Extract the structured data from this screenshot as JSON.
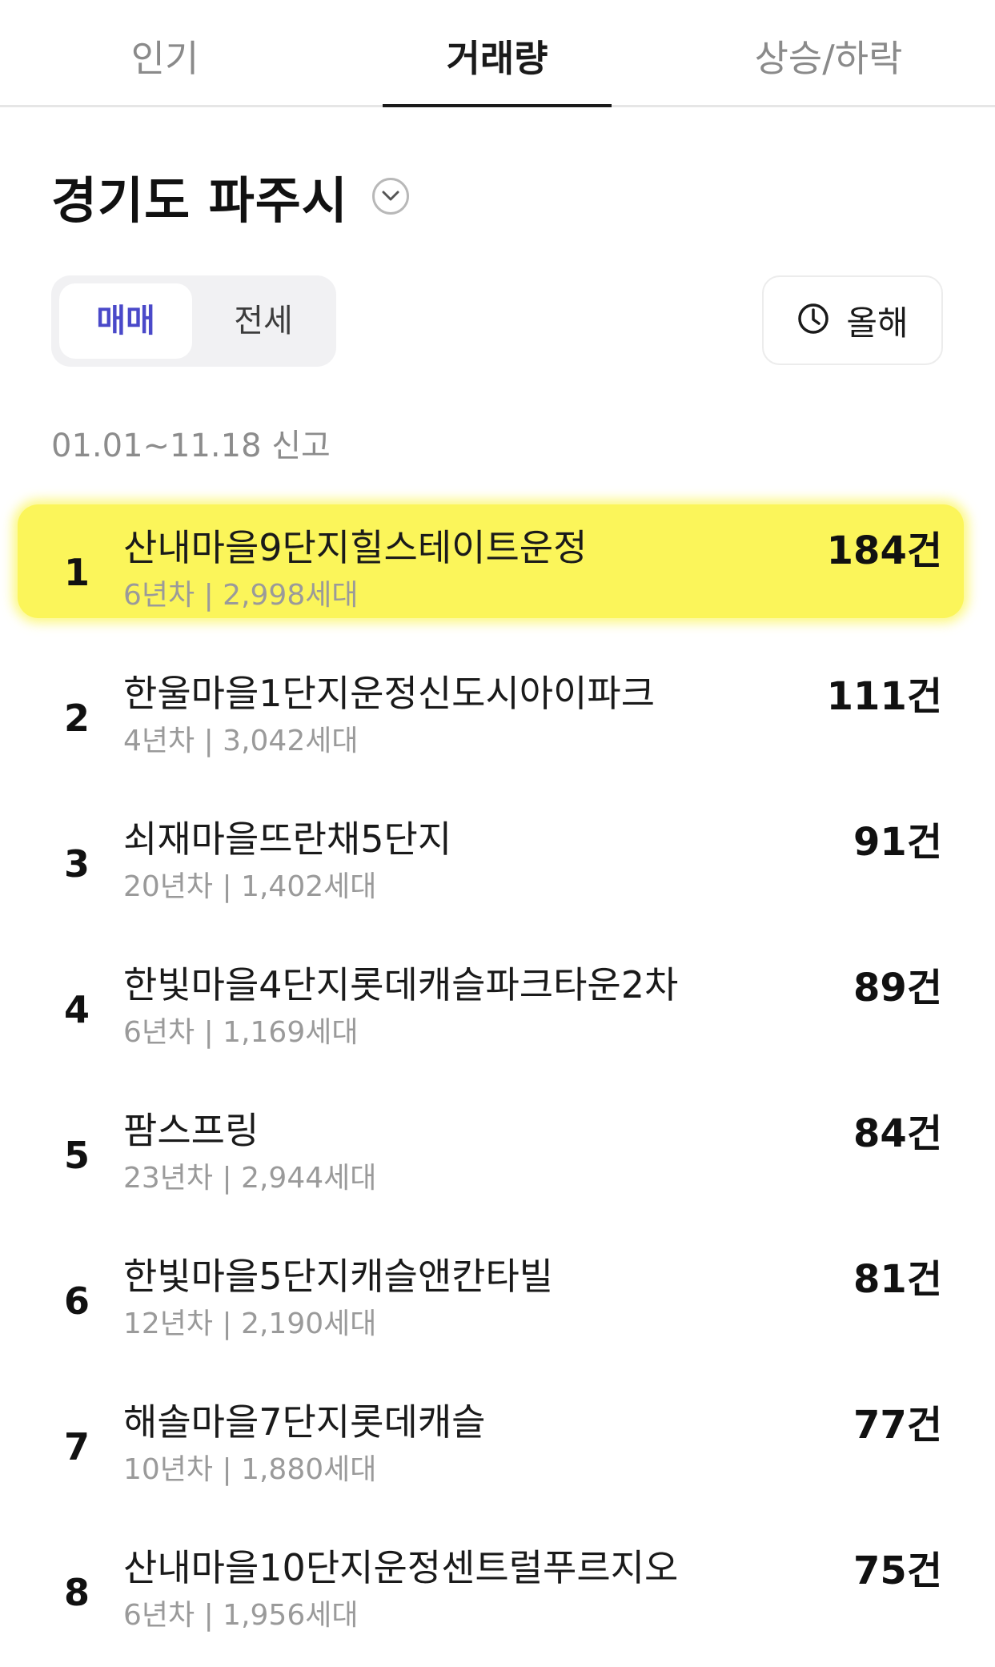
{
  "tabs": [
    {
      "label": "인기"
    },
    {
      "label": "거래량"
    },
    {
      "label": "상승/하락"
    }
  ],
  "active_tab": "거래량",
  "region": {
    "title": "경기도 파주시",
    "icon": "chevron-down-icon"
  },
  "segment": {
    "active": "매매",
    "inactive": "전세",
    "active_color": "#4a49c9"
  },
  "period": {
    "label": "올해",
    "icon": "clock-icon"
  },
  "date_range": "01.01~11.18 신고",
  "highlight_color": "#fbf55a",
  "rankings": [
    {
      "rank": "1",
      "name": "산내마을9단지힐스테이트운정",
      "meta": "6년차 | 2,998세대",
      "count": "184건"
    },
    {
      "rank": "2",
      "name": "한울마을1단지운정신도시아이파크",
      "meta": "4년차 | 3,042세대",
      "count": "111건"
    },
    {
      "rank": "3",
      "name": "쇠재마을뜨란채5단지",
      "meta": "20년차 | 1,402세대",
      "count": "91건"
    },
    {
      "rank": "4",
      "name": "한빛마을4단지롯데캐슬파크타운2차",
      "meta": "6년차 | 1,169세대",
      "count": "89건"
    },
    {
      "rank": "5",
      "name": "팜스프링",
      "meta": "23년차 | 2,944세대",
      "count": "84건"
    },
    {
      "rank": "6",
      "name": "한빛마을5단지캐슬앤칸타빌",
      "meta": "12년차 | 2,190세대",
      "count": "81건"
    },
    {
      "rank": "7",
      "name": "해솔마을7단지롯데캐슬",
      "meta": "10년차 | 1,880세대",
      "count": "77건"
    },
    {
      "rank": "8",
      "name": "산내마을10단지운정센트럴푸르지오",
      "meta": "6년차 | 1,956세대",
      "count": "75건"
    }
  ]
}
